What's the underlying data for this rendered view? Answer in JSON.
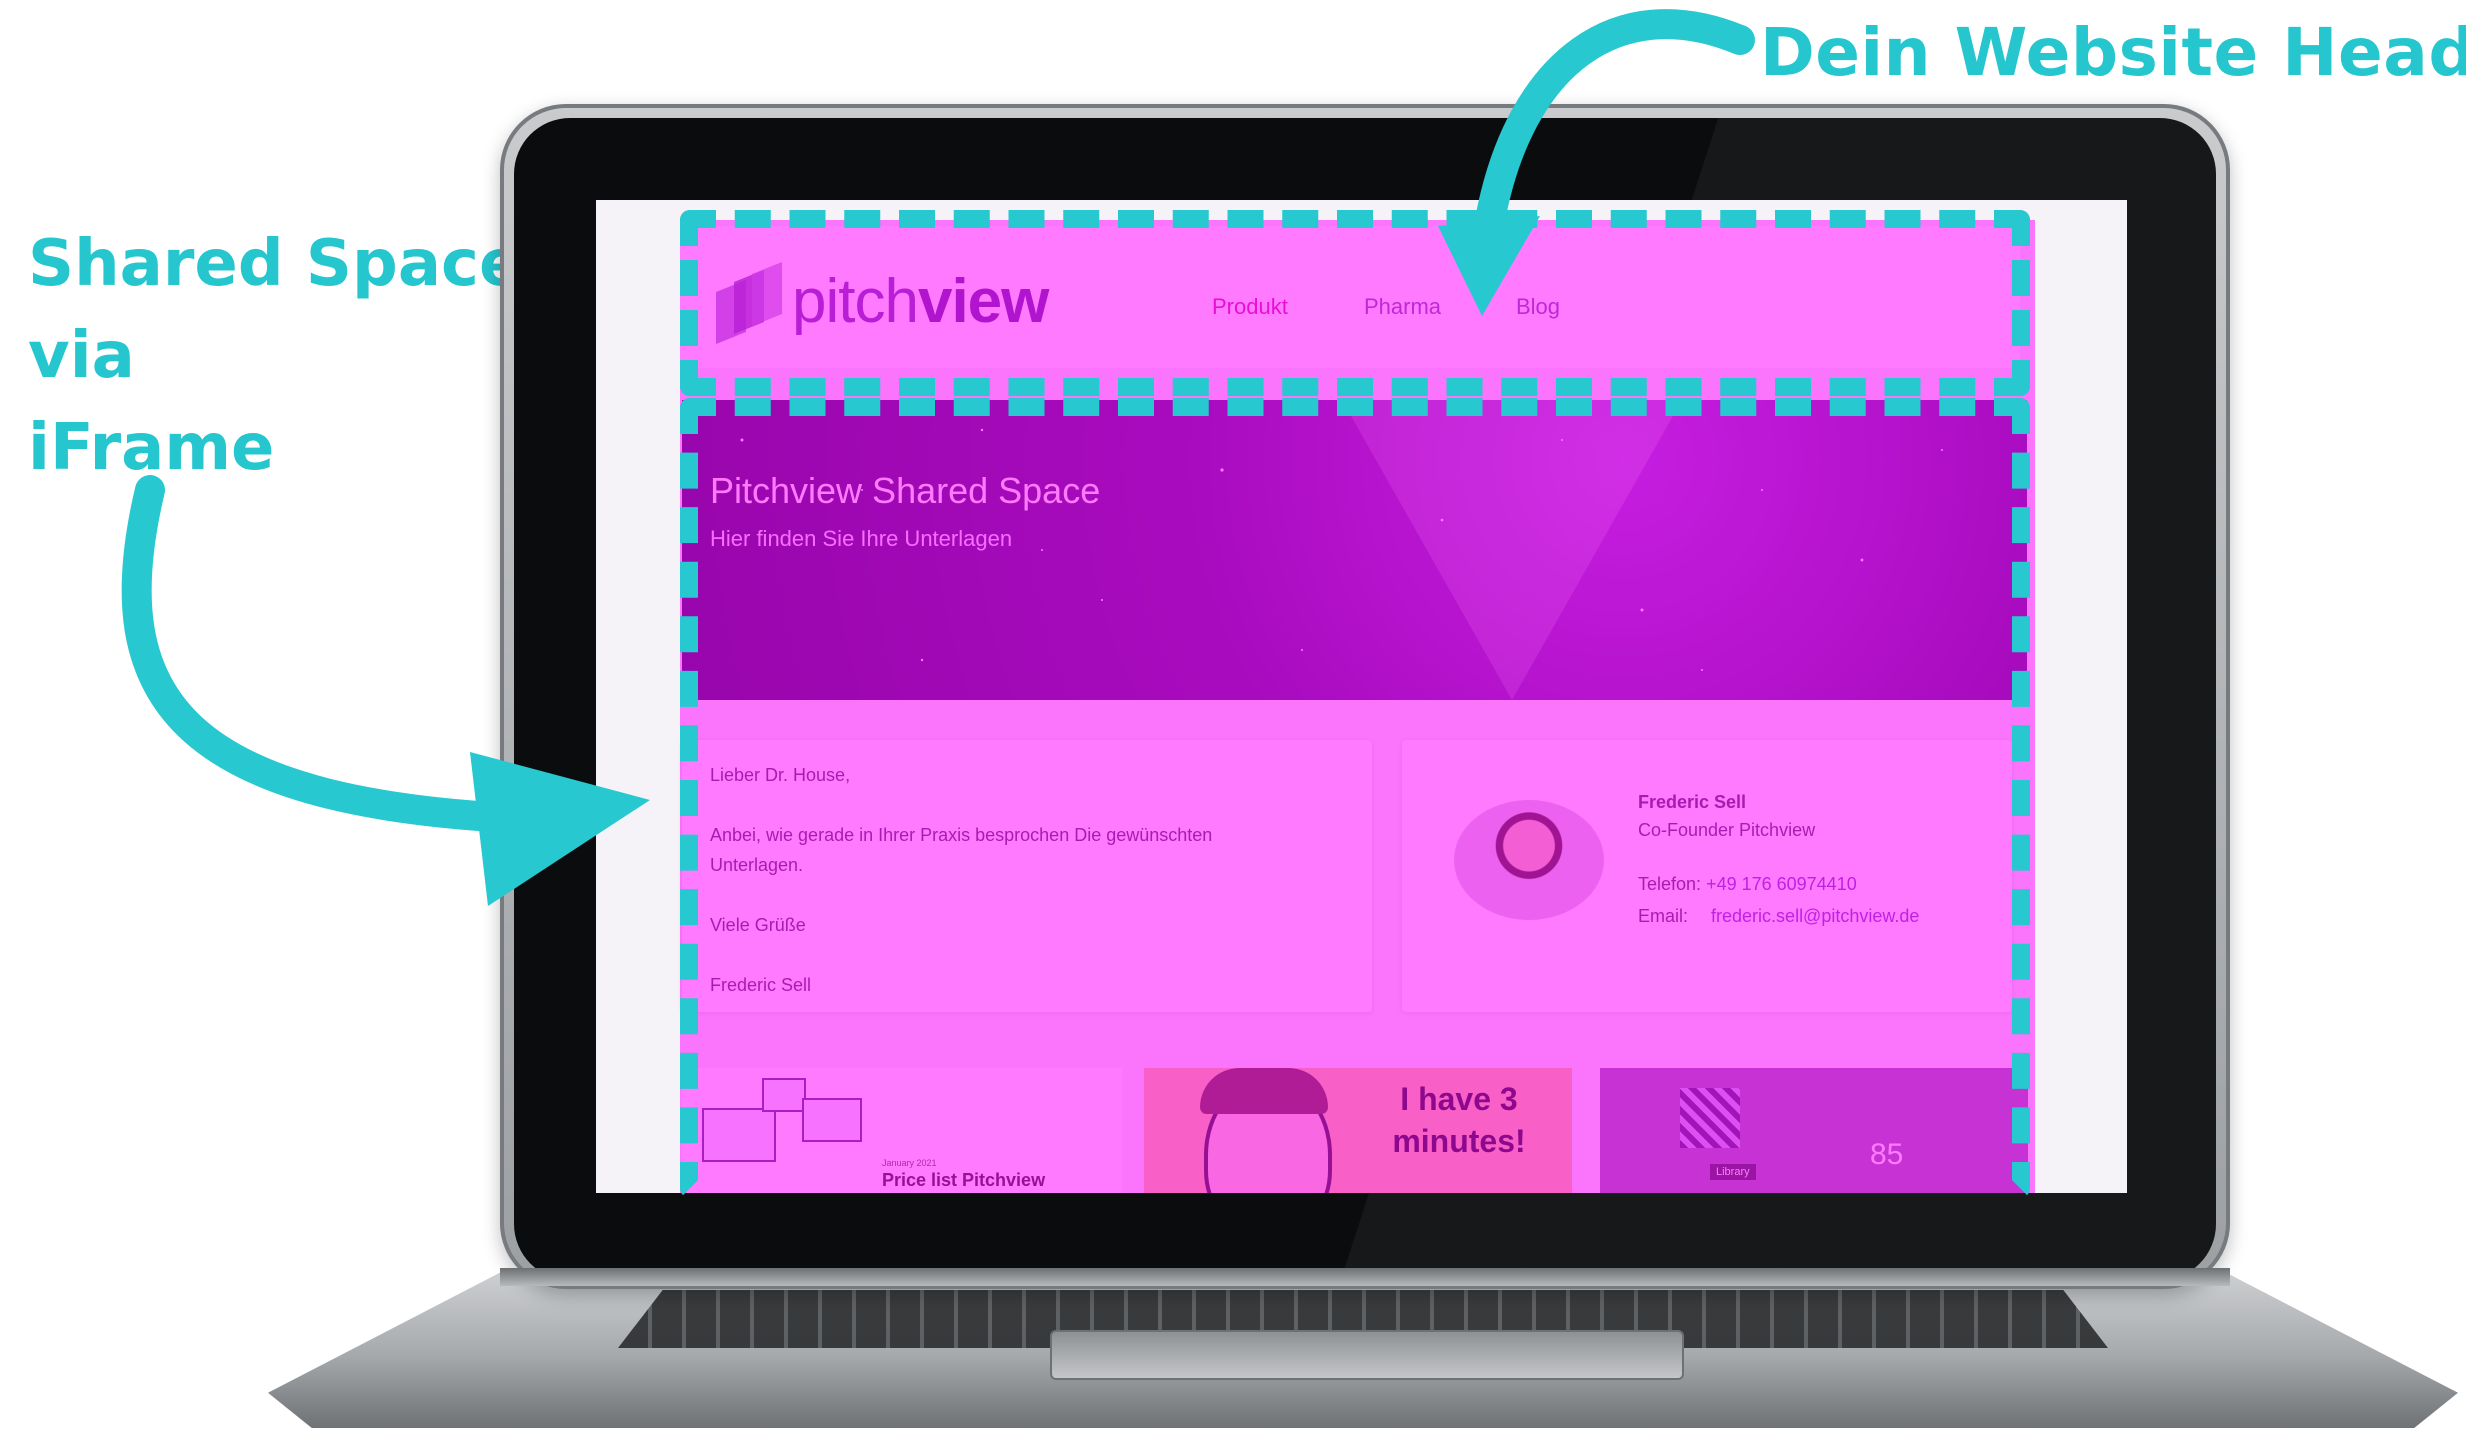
{
  "annotations": {
    "header_label": "Dein Website Header",
    "shared_lines": [
      "Shared Space",
      "via",
      "iFrame"
    ]
  },
  "colors": {
    "accent_teal": "#27c8cf",
    "overlay_magenta": "#ff00ff",
    "brand_purple": "#6a40a8"
  },
  "site": {
    "logo": {
      "text_light": "pitch",
      "text_bold": "view"
    },
    "nav": [
      {
        "label": "Produkt",
        "active": true
      },
      {
        "label": "Pharma",
        "active": false
      },
      {
        "label": "Blog",
        "active": false
      }
    ],
    "hero": {
      "title": "Pitchview Shared Space",
      "subtitle": "Hier finden Sie Ihre Unterlagen"
    },
    "letter": {
      "greeting": "Lieber Dr. House,",
      "body_line1": "Anbei, wie gerade in Ihrer Praxis besprochen   Die gewünschten",
      "body_line2": "Unterlagen.",
      "closing": "Viele Grüße",
      "signature": "Frederic Sell"
    },
    "contact": {
      "name": "Frederic Sell",
      "role": "Co-Founder Pitchview",
      "phone_label": "Telefon:",
      "phone": "+49 176 60974410",
      "email_label": "Email:",
      "email": "frederic.sell@pitchview.de"
    },
    "documents": [
      {
        "date": "January 2021",
        "title": "Price list Pitchview"
      },
      {
        "quote_line1": "I have 3",
        "quote_line2": "minutes!"
      },
      {
        "label": "Library",
        "number": "85"
      }
    ]
  }
}
